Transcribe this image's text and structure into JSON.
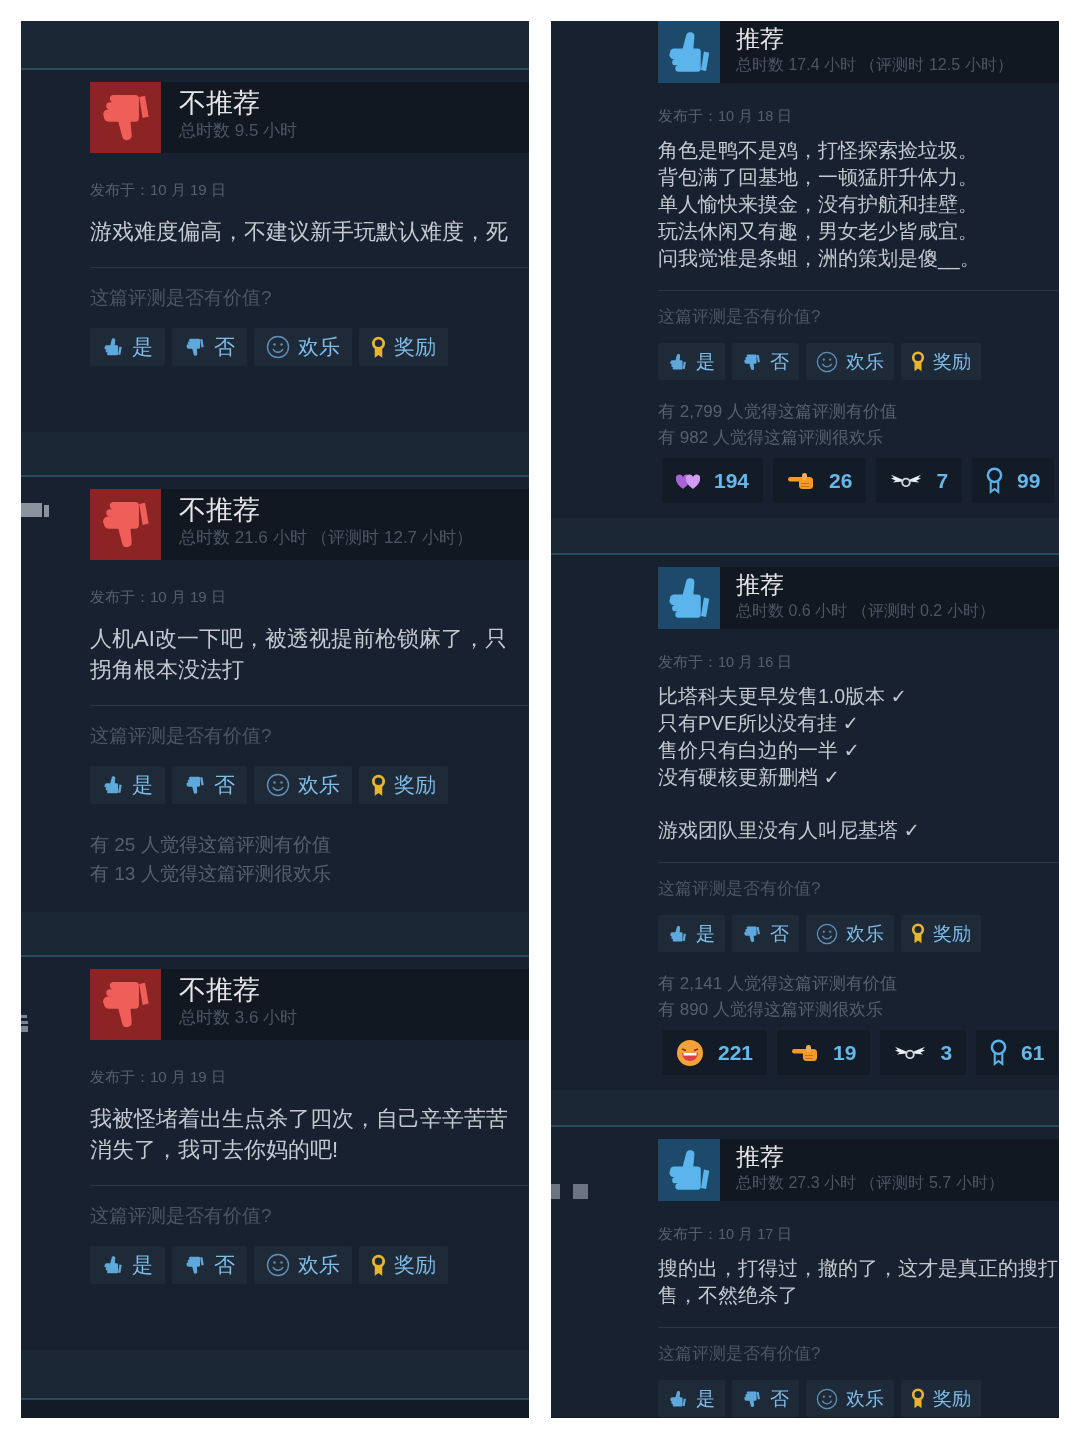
{
  "panels": [
    {
      "reviews": [
        {
          "recommended": false,
          "verdict": "不推荐",
          "playtime": "总时数 9.5 小时",
          "posted": "发布于：10 月 19 日",
          "paragraphs": [
            [
              "游戏难度偏高，不建议新手玩默认难度，死"
            ]
          ],
          "question": "这篇评测是否有价值?",
          "buttons": [
            {
              "kind": "yes",
              "label": "是"
            },
            {
              "kind": "no",
              "label": "否"
            },
            {
              "kind": "funny",
              "label": "欢乐"
            },
            {
              "kind": "award",
              "label": "奖励"
            }
          ]
        },
        {
          "recommended": false,
          "verdict": "不推荐",
          "playtime": "总时数 21.6 小时 （评测时 12.7 小时）",
          "side_mark": {
            "kind": "bar"
          },
          "posted": "发布于：10 月 19 日",
          "paragraphs": [
            [
              "人机AI改一下吧，被透视提前枪锁麻了，只",
              "拐角根本没法打"
            ]
          ],
          "question": "这篇评测是否有价值?",
          "buttons": [
            {
              "kind": "yes",
              "label": "是"
            },
            {
              "kind": "no",
              "label": "否"
            },
            {
              "kind": "funny",
              "label": "欢乐"
            },
            {
              "kind": "award",
              "label": "奖励"
            }
          ],
          "stats": [
            "有 25 人觉得这篇评测有价值",
            "有 13 人觉得这篇评测很欢乐"
          ]
        },
        {
          "recommended": false,
          "verdict": "不推荐",
          "playtime": "总时数 3.6 小时",
          "side_mark": {
            "kind": "glyph"
          },
          "posted": "发布于：10 月 19 日",
          "paragraphs": [
            [
              "我被怪堵着出生点杀了四次，自己辛辛苦苦",
              "消失了，我可去你妈的吧!"
            ]
          ],
          "question": "这篇评测是否有价值?",
          "buttons": [
            {
              "kind": "yes",
              "label": "是"
            },
            {
              "kind": "no",
              "label": "否"
            },
            {
              "kind": "funny",
              "label": "欢乐"
            },
            {
              "kind": "award",
              "label": "奖励"
            }
          ]
        }
      ]
    },
    {
      "reviews": [
        {
          "recommended": true,
          "verdict": "推荐",
          "playtime": "总时数 17.4 小时 （评测时 12.5 小时）",
          "posted": "发布于：10 月 18 日",
          "paragraphs": [
            [
              "角色是鸭不是鸡，打怪探索捡垃圾。",
              "背包满了回基地，一顿猛肝升体力。",
              "单人愉快来摸金，没有护航和挂壁。",
              "玩法休闲又有趣，男女老少皆咸宜。",
              "问我觉谁是条蛆，洲的策划是傻__。"
            ]
          ],
          "question": "这篇评测是否有价值?",
          "buttons": [
            {
              "kind": "yes",
              "label": "是"
            },
            {
              "kind": "no",
              "label": "否"
            },
            {
              "kind": "funny",
              "label": "欢乐"
            },
            {
              "kind": "award",
              "label": "奖励"
            }
          ],
          "stats": [
            "有 2,799 人觉得这篇评测有价值",
            "有 982 人觉得这篇评测很欢乐"
          ],
          "awards": [
            {
              "kind": "hearts",
              "count": "194"
            },
            {
              "kind": "pointer",
              "count": "26"
            },
            {
              "kind": "wings",
              "count": "7"
            },
            {
              "kind": "ribbon",
              "count": "99"
            }
          ]
        },
        {
          "recommended": true,
          "verdict": "推荐",
          "playtime": "总时数 0.6 小时 （评测时 0.2 小时）",
          "posted": "发布于：10 月 16 日",
          "paragraphs": [
            [
              "比塔科夫更早发售1.0版本 ✓",
              "只有PVE所以没有挂 ✓",
              "售价只有白边的一半 ✓",
              "没有硬核更新删档 ✓"
            ],
            [
              "游戏团队里没有人叫尼基塔 ✓"
            ]
          ],
          "question": "这篇评测是否有价值?",
          "buttons": [
            {
              "kind": "yes",
              "label": "是"
            },
            {
              "kind": "no",
              "label": "否"
            },
            {
              "kind": "funny",
              "label": "欢乐"
            },
            {
              "kind": "award",
              "label": "奖励"
            }
          ],
          "stats": [
            "有 2,141 人觉得这篇评测有价值",
            "有 890 人觉得这篇评测很欢乐"
          ],
          "awards": [
            {
              "kind": "laughing",
              "count": "221"
            },
            {
              "kind": "pointer",
              "count": "19"
            },
            {
              "kind": "wings",
              "count": "3"
            },
            {
              "kind": "ribbon",
              "count": "61"
            }
          ]
        },
        {
          "recommended": true,
          "verdict": "推荐",
          "playtime": "总时数 27.3 小时 （评测时 5.7 小时）",
          "side_mark": {
            "kind": "squares"
          },
          "posted": "发布于：10 月 17 日",
          "paragraphs": [
            [
              "搜的出，打得过，撤的了，这才是真正的搜打",
              "售，不然绝杀了"
            ]
          ],
          "question": "这篇评测是否有价值?",
          "buttons": [
            {
              "kind": "yes",
              "label": "是"
            },
            {
              "kind": "no",
              "label": "否"
            },
            {
              "kind": "funny",
              "label": "欢乐"
            },
            {
              "kind": "award",
              "label": "奖励"
            }
          ]
        }
      ]
    }
  ]
}
